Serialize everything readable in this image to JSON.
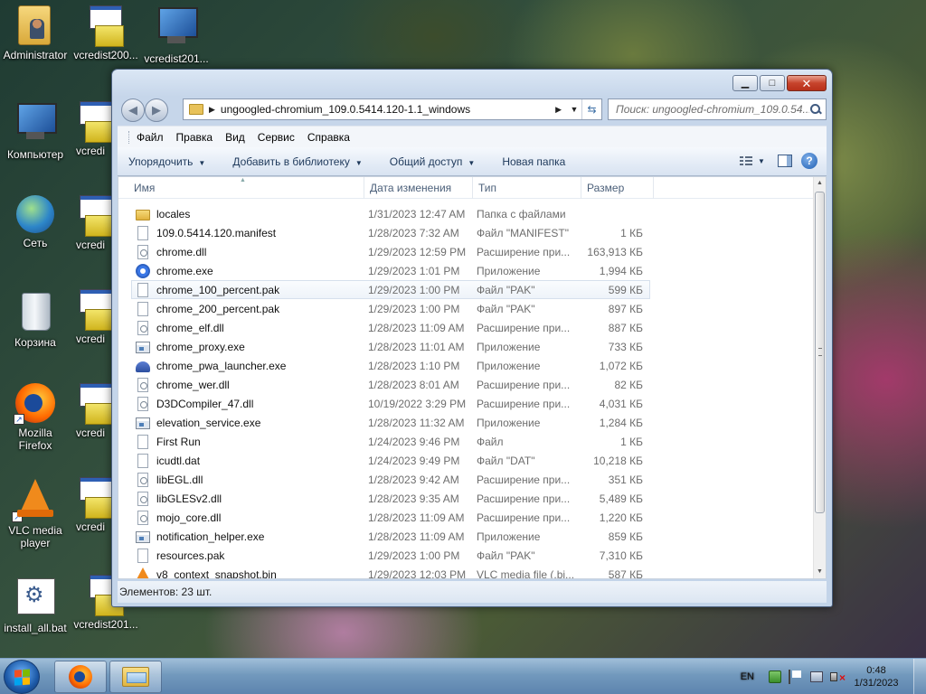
{
  "desktop": {
    "icons": [
      {
        "label": "Administrator"
      },
      {
        "label": "vcredist200..."
      },
      {
        "label": "vcredist201..."
      },
      {
        "label": "Компьютер"
      },
      {
        "label": "vcredi"
      },
      {
        "label": "Сеть"
      },
      {
        "label": "vcredi"
      },
      {
        "label": "Корзина"
      },
      {
        "label": "vcredi"
      },
      {
        "label": "Mozilla Firefox"
      },
      {
        "label": "vcredi"
      },
      {
        "label": "VLC media player"
      },
      {
        "label": "vcredi"
      },
      {
        "label": "install_all.bat"
      },
      {
        "label": "vcredist201..."
      }
    ]
  },
  "window": {
    "address_path": "ungoogled-chromium_109.0.5414.120-1.1_windows",
    "search_placeholder": "Поиск: ungoogled-chromium_109.0.54...",
    "menu": [
      "Файл",
      "Правка",
      "Вид",
      "Сервис",
      "Справка"
    ],
    "commands": [
      "Упорядочить",
      "Добавить в библиотеку",
      "Общий доступ",
      "Новая папка"
    ],
    "columns": {
      "name": "Имя",
      "date": "Дата изменения",
      "type": "Тип",
      "size": "Размер"
    },
    "files": [
      {
        "name": "locales",
        "date": "1/31/2023 12:47 AM",
        "type": "Папка с файлами",
        "size": "",
        "icon": "folder"
      },
      {
        "name": "109.0.5414.120.manifest",
        "date": "1/28/2023 7:32 AM",
        "type": "Файл \"MANIFEST\"",
        "size": "1 КБ",
        "icon": "file"
      },
      {
        "name": "chrome.dll",
        "date": "1/29/2023 12:59 PM",
        "type": "Расширение при...",
        "size": "163,913 КБ",
        "icon": "dll"
      },
      {
        "name": "chrome.exe",
        "date": "1/29/2023 1:01 PM",
        "type": "Приложение",
        "size": "1,994 КБ",
        "icon": "chrome"
      },
      {
        "name": "chrome_100_percent.pak",
        "date": "1/29/2023 1:00 PM",
        "type": "Файл \"PAK\"",
        "size": "599 КБ",
        "icon": "file"
      },
      {
        "name": "chrome_200_percent.pak",
        "date": "1/29/2023 1:00 PM",
        "type": "Файл \"PAK\"",
        "size": "897 КБ",
        "icon": "file"
      },
      {
        "name": "chrome_elf.dll",
        "date": "1/28/2023 11:09 AM",
        "type": "Расширение при...",
        "size": "887 КБ",
        "icon": "dll"
      },
      {
        "name": "chrome_proxy.exe",
        "date": "1/28/2023 11:01 AM",
        "type": "Приложение",
        "size": "733 КБ",
        "icon": "exe"
      },
      {
        "name": "chrome_pwa_launcher.exe",
        "date": "1/28/2023 1:10 PM",
        "type": "Приложение",
        "size": "1,072 КБ",
        "icon": "pwa"
      },
      {
        "name": "chrome_wer.dll",
        "date": "1/28/2023 8:01 AM",
        "type": "Расширение при...",
        "size": "82 КБ",
        "icon": "dll"
      },
      {
        "name": "D3DCompiler_47.dll",
        "date": "10/19/2022 3:29 PM",
        "type": "Расширение при...",
        "size": "4,031 КБ",
        "icon": "dll"
      },
      {
        "name": "elevation_service.exe",
        "date": "1/28/2023 11:32 AM",
        "type": "Приложение",
        "size": "1,284 КБ",
        "icon": "exe"
      },
      {
        "name": "First Run",
        "date": "1/24/2023 9:46 PM",
        "type": "Файл",
        "size": "1 КБ",
        "icon": "file"
      },
      {
        "name": "icudtl.dat",
        "date": "1/24/2023 9:49 PM",
        "type": "Файл \"DAT\"",
        "size": "10,218 КБ",
        "icon": "file"
      },
      {
        "name": "libEGL.dll",
        "date": "1/28/2023 9:42 AM",
        "type": "Расширение при...",
        "size": "351 КБ",
        "icon": "dll"
      },
      {
        "name": "libGLESv2.dll",
        "date": "1/28/2023 9:35 AM",
        "type": "Расширение при...",
        "size": "5,489 КБ",
        "icon": "dll"
      },
      {
        "name": "mojo_core.dll",
        "date": "1/28/2023 11:09 AM",
        "type": "Расширение при...",
        "size": "1,220 КБ",
        "icon": "dll"
      },
      {
        "name": "notification_helper.exe",
        "date": "1/28/2023 11:09 AM",
        "type": "Приложение",
        "size": "859 КБ",
        "icon": "exe"
      },
      {
        "name": "resources.pak",
        "date": "1/29/2023 1:00 PM",
        "type": "Файл \"PAK\"",
        "size": "7,310 КБ",
        "icon": "file"
      },
      {
        "name": "v8_context_snapshot.bin",
        "date": "1/29/2023 12:03 PM",
        "type": "VLC media file (.bi...",
        "size": "587 КБ",
        "icon": "vlc"
      }
    ],
    "hovered_index": 4,
    "status": "Элементов: 23 шт."
  },
  "taskbar": {
    "lang": "EN",
    "time": "0:48",
    "date": "1/31/2023"
  }
}
